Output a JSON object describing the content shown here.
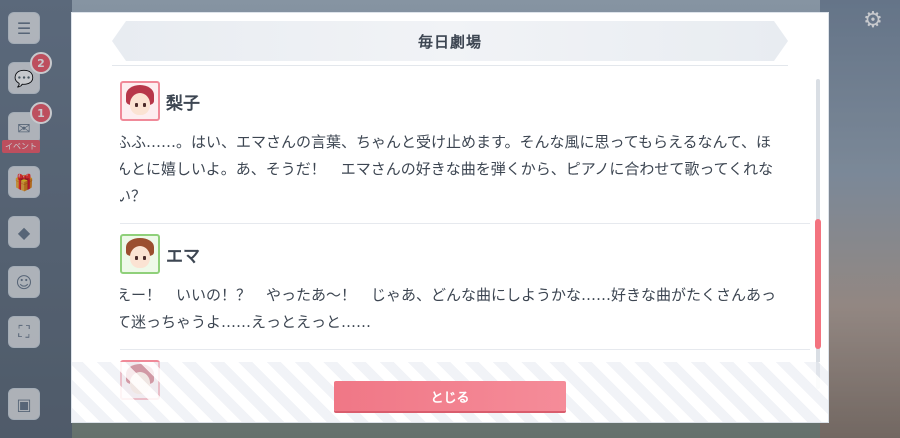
{
  "dialog": {
    "title": "毎日劇場",
    "close_label": "とじる"
  },
  "side_menu": {
    "badges": [
      "2",
      "1"
    ],
    "event_label": "イベント"
  },
  "entries": [
    {
      "speaker": "梨子",
      "avatar_color": "#f08a99",
      "text": "ふふ……。はい、エマさんの言葉、ちゃんと受け止めます。そんな風に思ってもらえるなんて、ほんとに嬉しいよ。あ、そうだ！　エマさんの好きな曲を弾くから、ピアノに合わせて歌ってくれない？"
    },
    {
      "speaker": "エマ",
      "avatar_color": "#8fd07a",
      "text": "えー！　いいの！？　やったあ～！　じゃあ、どんな曲にしようかな……好きな曲がたくさんあって迷っちゃうよ……えっとえっと……"
    }
  ],
  "colors": {
    "accent": "#f07786",
    "text": "#3d4652"
  }
}
